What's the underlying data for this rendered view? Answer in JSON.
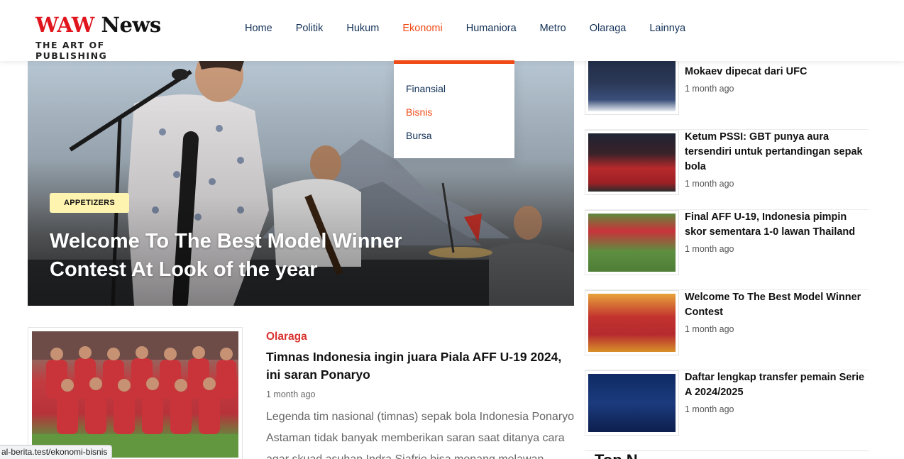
{
  "header": {
    "logo_main_part1": "WAW",
    "logo_main_part2": "News",
    "logo_tagline": "THE ART OF PUBLISHING",
    "nav": [
      "Home",
      "Politik",
      "Hukum",
      "Ekonomi",
      "Humaniora",
      "Metro",
      "Olaraga",
      "Lainnya"
    ],
    "active_nav": "Ekonomi"
  },
  "dropdown": {
    "items": [
      "Finansial",
      "Bisnis",
      "Bursa"
    ],
    "active": "Bisnis"
  },
  "hero": {
    "badge": "APPETIZERS",
    "title": "Welcome To The Best Model Winner Contest At Look of the year"
  },
  "article": {
    "category": "Olaraga",
    "title": "Timnas Indonesia ingin juara Piala AFF U-19 2024, ini saran Ponaryo",
    "time": "1 month ago",
    "excerpt": "Legenda tim nasional (timnas) sepak bola Indonesia Ponaryo Astaman tidak banyak memberikan saran saat ditanya cara agar skuad asuhan Indra Sjafrie bisa menang melawan"
  },
  "sidebar": {
    "items": [
      {
        "title": "Mokaev dipecat dari UFC",
        "time": "1 month ago"
      },
      {
        "title": "Ketum PSSI: GBT punya aura tersendiri untuk pertandingan sepak bola",
        "time": "1 month ago"
      },
      {
        "title": "Final AFF U-19, Indonesia pimpin skor sementara 1-0 lawan Thailand",
        "time": "1 month ago"
      },
      {
        "title": "Welcome To The Best Model Winner Contest",
        "time": "1 month ago"
      },
      {
        "title": "Daftar lengkap transfer pemain Serie A 2024/2025",
        "time": "1 month ago"
      }
    ],
    "next_heading": "Top N"
  },
  "statusbar": {
    "url": "al-berita.test/ekonomi-bisnis"
  },
  "colors": {
    "accent": "#f04a16",
    "nav_text": "#123056",
    "logo_red": "#e0151d",
    "category_red": "#d8322f",
    "badge_bg": "#fff3b0"
  }
}
